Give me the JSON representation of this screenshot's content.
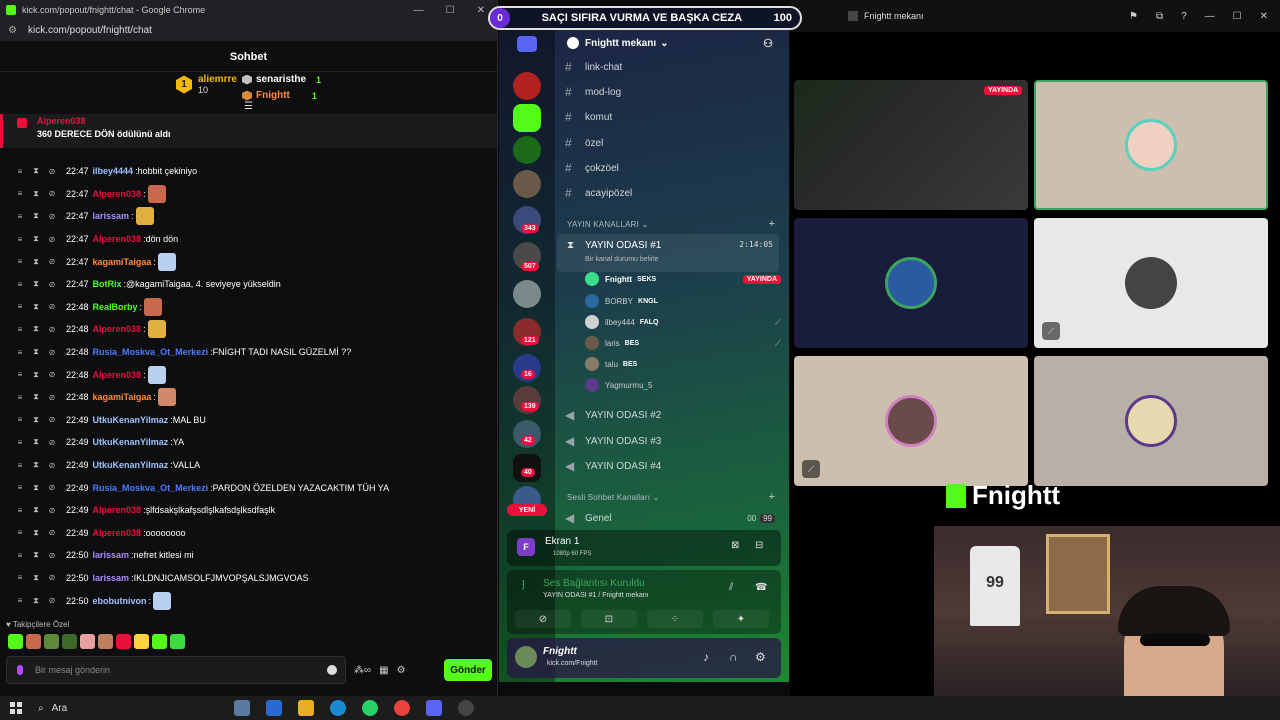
{
  "chrome": {
    "window_title": "kick.com/popout/fnightt/chat - Google Chrome",
    "url": "kick.com/popout/fnightt/chat"
  },
  "chat": {
    "header": "Sohbet",
    "leaderboard": {
      "first": {
        "rank": "1",
        "name": "aliemrre",
        "count": "10"
      },
      "second": {
        "name": "senaristhe",
        "count": "1"
      },
      "third": {
        "name": "Fnightt",
        "count": "1"
      }
    },
    "pinned": {
      "user": "Alperen038",
      "text": "360 DERECE DÖN ödülünü aldı"
    },
    "messages": [
      {
        "time": "22:47",
        "user": "ilbey4444",
        "color": "#9cc3ff",
        "text": "hobbit çekiniyo"
      },
      {
        "time": "22:47",
        "user": "Alperen038",
        "color": "#e9113c",
        "text": ""
      },
      {
        "time": "22:47",
        "user": "larissam",
        "color": "#a98cff",
        "text": ""
      },
      {
        "time": "22:47",
        "user": "Alperen038",
        "color": "#e9113c",
        "text": "dön dön"
      },
      {
        "time": "22:47",
        "user": "kagamiTaigaa",
        "color": "#ff8a3c",
        "text": ""
      },
      {
        "time": "22:47",
        "user": "BotRix",
        "color": "#53fc18",
        "text": "@kagamiTaigaa, 4. seviyeye yükseldin"
      },
      {
        "time": "22:48",
        "user": "RealBorby",
        "color": "#53fc18",
        "text": ""
      },
      {
        "time": "22:48",
        "user": "Alperen038",
        "color": "#e9113c",
        "text": ""
      },
      {
        "time": "22:48",
        "user": "Rusia_Moskva_Ot_Merkezi",
        "color": "#4c7dff",
        "text": "FNİGHT TADI NASIL GÜZELMİ ??"
      },
      {
        "time": "22:48",
        "user": "Alperen038",
        "color": "#e9113c",
        "text": ""
      },
      {
        "time": "22:48",
        "user": "kagamiTaigaa",
        "color": "#ff8a3c",
        "text": ""
      },
      {
        "time": "22:49",
        "user": "UtkuKenanYilmaz",
        "color": "#9cc3ff",
        "text": "MAL BU"
      },
      {
        "time": "22:49",
        "user": "UtkuKenanYilmaz",
        "color": "#9cc3ff",
        "text": "YA"
      },
      {
        "time": "22:49",
        "user": "UtkuKenanYilmaz",
        "color": "#9cc3ff",
        "text": "VALLA"
      },
      {
        "time": "22:49",
        "user": "Rusia_Moskva_Ot_Merkezi",
        "color": "#4c7dff",
        "text": "PARDON ÖZELDEN YAZACAKTIM TÜH YA"
      },
      {
        "time": "22:49",
        "user": "Alperen038",
        "color": "#e9113c",
        "text": "şlfdsakşlkafşsdlşlkafsdşlksdfaşlk"
      },
      {
        "time": "22:49",
        "user": "Alperen038",
        "color": "#e9113c",
        "text": "oooooooo"
      },
      {
        "time": "22:50",
        "user": "larissam",
        "color": "#a98cff",
        "text": "nefret kitlesi mi"
      },
      {
        "time": "22:50",
        "user": "larissam",
        "color": "#a98cff",
        "text": "IKLDNJICAMSOLFJMVOPŞALSJMGVOAS"
      },
      {
        "time": "22:50",
        "user": "ebobutnivon",
        "color": "#9cc3ff",
        "text": ""
      }
    ],
    "followers_only": "Takipçilere Özel",
    "input_placeholder": "Bir mesaj gönderin",
    "send_label": "Gönder"
  },
  "challenge": {
    "left": "0",
    "title": "SAÇI SIFIRA VURMA VE BAŞKA CEZA",
    "right": "100"
  },
  "discord": {
    "guild": "Fnightt mekanı",
    "badges": [
      "343",
      "507",
      "121",
      "16",
      "139",
      "42",
      "40"
    ],
    "new_label": "YENİ",
    "text_channels": [
      "link-chat",
      "mod-log",
      "komut",
      "özel",
      "çokzöel",
      "acayipözel"
    ],
    "voice_category": "YAYIN KANALLARI",
    "active_voice": {
      "name": "YAYIN ODASI #1",
      "time": "2:14:05",
      "status": "Bir kanal durumu belirle"
    },
    "voice_users": [
      {
        "name": "Fnightt",
        "tag": "SEKS",
        "live": "YAYINDA"
      },
      {
        "name": "BORBY",
        "tag": "KNGL"
      },
      {
        "name": "ilbey444",
        "tag": "FALQ"
      },
      {
        "name": "laris",
        "tag": "BES"
      },
      {
        "name": "talu",
        "tag": "BES"
      },
      {
        "name": "Yagmurmu_5",
        "tag": ""
      }
    ],
    "other_voice": [
      "YAYIN ODASI #2",
      "YAYIN ODASI #3",
      "YAYIN ODASI #4"
    ],
    "chat_category": "Sesli Sohbet Kanalları",
    "general": {
      "name": "Genel",
      "a": "00",
      "b": "99"
    },
    "stream": {
      "title": "Ekran 1",
      "sub": "1080p 60 FPS"
    },
    "voice_conn": {
      "title": "Ses Bağlantısı Kuruldu",
      "sub": "YAYIN ODASI #1 / Fnightt mekanı"
    },
    "user": {
      "name": "Fnightt",
      "sub": "kick.com/Fnightt"
    }
  },
  "stream_window": {
    "title": "Fnightt mekanı",
    "live_label": "YAYINDA",
    "brand": "Fnightt"
  },
  "taskbar": {
    "search": "Ara"
  }
}
